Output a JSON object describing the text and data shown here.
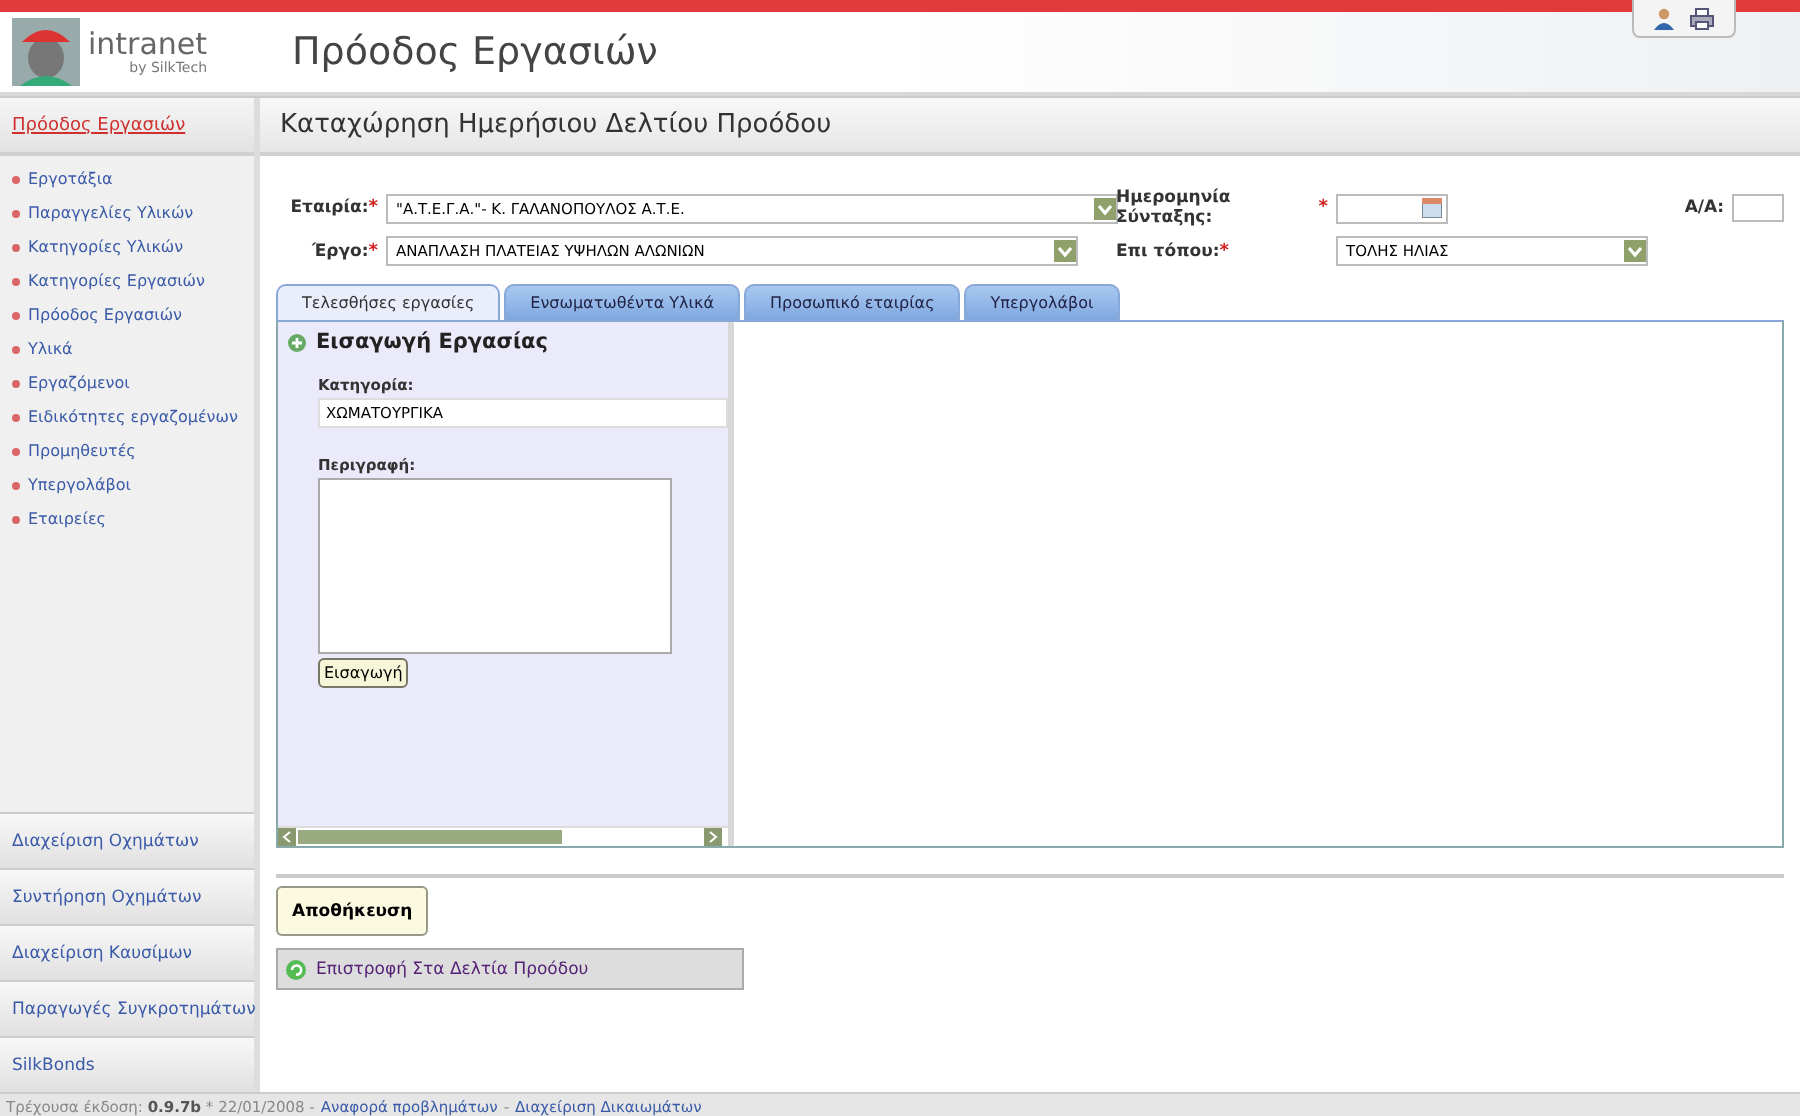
{
  "header": {
    "logo_title": "intranet",
    "logo_subtitle": "by SilkTech",
    "title": "Πρόοδος Εργασιών"
  },
  "sidebar": {
    "section_title": "Πρόοδος Εργασιών",
    "items": [
      {
        "label": "Εργοτάξια"
      },
      {
        "label": "Παραγγελίες Υλικών"
      },
      {
        "label": "Κατηγορίες Υλικών"
      },
      {
        "label": "Κατηγορίες Εργασιών"
      },
      {
        "label": "Πρόοδος Εργασιών"
      },
      {
        "label": "Υλικά"
      },
      {
        "label": "Εργαζόμενοι"
      },
      {
        "label": "Ειδικότητες εργαζομένων"
      },
      {
        "label": "Προμηθευτές"
      },
      {
        "label": "Υπεργολάβοι"
      },
      {
        "label": "Εταιρείες"
      }
    ],
    "sections": [
      "Διαχείριση Οχημάτων",
      "Συντήρηση Οχημάτων",
      "Διαχείριση Καυσίμων",
      "Παραγωγές Συγκροτημάτων",
      "SilkBonds"
    ]
  },
  "page_title": "Καταχώρηση Ημερήσιου Δελτίου Προόδου",
  "form": {
    "fields": [
      {
        "label": "Εταιρία:",
        "required_mark": "*",
        "kind": "select",
        "value": "\"Α.Τ.Ε.Γ.Α.\"- Κ. ΓΑΛΑΝΟΠΟΥΛΟΣ Α.Τ.Ε."
      },
      {
        "label": "Ημερομηνία Σύνταξης:",
        "required_mark": "*",
        "kind": "date"
      },
      {
        "label": "Α/Α:",
        "kind": "text"
      },
      {
        "label": "Έργο:",
        "required_mark": "*",
        "kind": "select",
        "value": "ΑΝΑΠΛΑΣΗ ΠΛΑΤΕΙΑΣ ΥΨΗΛΩΝ ΑΛΩΝΙΩΝ"
      },
      {
        "label": "Επι τόπου:",
        "required_mark": "*",
        "kind": "select",
        "value": "ΤΟΛΗΣ ΗΛΙΑΣ"
      }
    ]
  },
  "tabs": [
    {
      "label": "Τελεσθήσες εργασίες",
      "selected": true
    },
    {
      "label": "Ενσωματωθέντα Υλικά",
      "selected": false
    },
    {
      "label": "Προσωπικό εταιρίας",
      "selected": false
    },
    {
      "label": "Υπεργολάβοι",
      "selected": false
    }
  ],
  "entry_panel": {
    "title": "Εισαγωγή Εργασίας",
    "category_label": "Κατηγορία:",
    "category_value": "ΧΩΜΑΤΟΥΡΓΙΚΑ",
    "description_label": "Περιγραφή:",
    "insert_button": "Εισαγωγή"
  },
  "save_button": "Αποθήκευση",
  "back_link": "Επιστροφή Στα Δελτία Προόδου",
  "status_bar": {
    "version": "Τρέχουσα έκδοση: **0.9.7b** * 22/01/2008 -",
    "links": [
      "Αναφορά προβλημάτων",
      "Διαχείριση Δικαιωμάτων"
    ],
    "separator": "-"
  }
}
